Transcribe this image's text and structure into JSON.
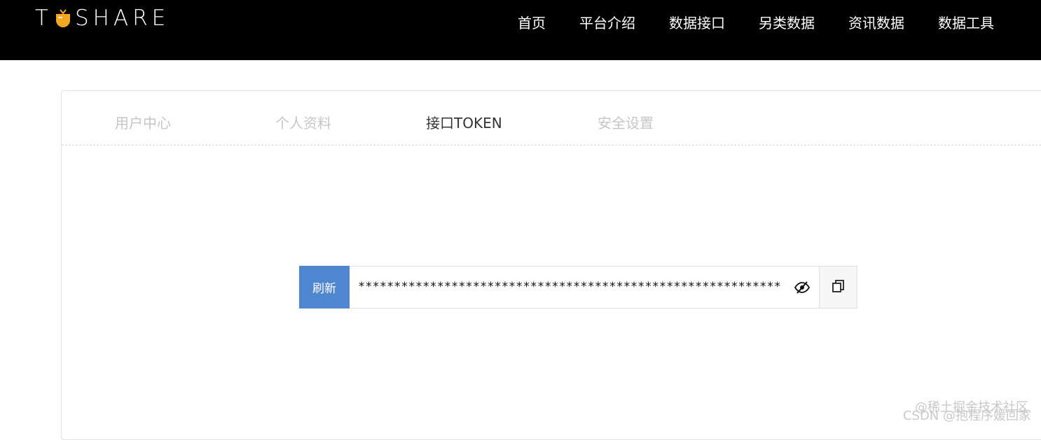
{
  "header": {
    "logo_text_left": "T",
    "logo_text_right": "SHARE",
    "nav": [
      "首页",
      "平台介绍",
      "数据接口",
      "另类数据",
      "资讯数据",
      "数据工具"
    ]
  },
  "tabs": [
    {
      "label": "用户中心",
      "active": false
    },
    {
      "label": "个人资料",
      "active": false
    },
    {
      "label": "接口TOKEN",
      "active": true
    },
    {
      "label": "安全设置",
      "active": false
    }
  ],
  "token": {
    "refresh_label": "刷新",
    "value": "**************************************************************",
    "eye_icon": "eye-slash-icon",
    "copy_icon": "copy-icon"
  },
  "watermark": {
    "line1": "@稀土掘金技术社区",
    "line2": "CSDN @抱程序媛回家"
  },
  "colors": {
    "topbar": "#000000",
    "refresh_button": "#4e86cf",
    "active_tab": "#333333",
    "inactive_tab": "#c6c6c6",
    "logo_accent": "#f5a623"
  }
}
